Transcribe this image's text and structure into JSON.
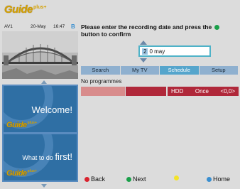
{
  "header": {
    "logo": "Guide",
    "logo_suffix": "plus+"
  },
  "preview": {
    "source": "AV1",
    "date": "20-May",
    "time": "16:47",
    "lock_glyph": "B"
  },
  "promos": [
    {
      "text": "Welcome!"
    },
    {
      "text_pre": "What to do ",
      "text_emph": "first!"
    }
  ],
  "prompt": {
    "before": "Please enter the recording date and press the",
    "after": "button to confirm"
  },
  "date_entry": {
    "day": "2",
    "value": "0 may"
  },
  "tabs": [
    {
      "label": "Search"
    },
    {
      "label": "My TV"
    },
    {
      "label": "Schedule"
    },
    {
      "label": "Setup"
    }
  ],
  "active_tab": "Schedule",
  "status": "No programmes",
  "timeline_entry": {
    "device": "HDD",
    "mode": "Once",
    "channel": "<0,0>"
  },
  "footer": {
    "back": "Back",
    "next": "Next",
    "yellow": "",
    "home": "Home"
  },
  "colors": {
    "red": "#d9232e",
    "green": "#1aa04a",
    "yellow": "#f3e32a",
    "blue": "#3a8fd0"
  }
}
